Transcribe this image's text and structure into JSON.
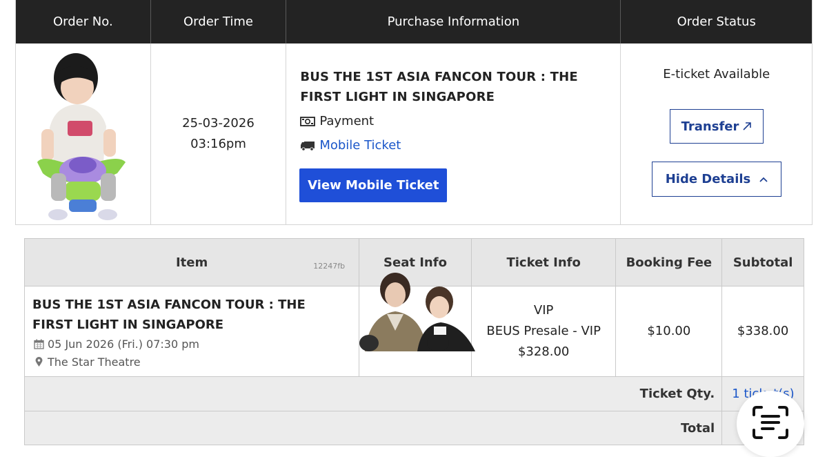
{
  "orders_table": {
    "headers": [
      "Order No.",
      "Order Time",
      "Purchase Information",
      "Order Status"
    ],
    "order_date": "25-03-2026",
    "order_time": "03:16pm",
    "event_title": "BUS THE 1ST ASIA FANCON TOUR : THE FIRST LIGHT IN SINGAPORE",
    "payment_label": "Payment",
    "delivery_label": "Mobile Ticket",
    "view_button": "View Mobile Ticket",
    "status": "E-ticket Available",
    "transfer_button": "Transfer",
    "hide_details_button": "Hide Details"
  },
  "details_table": {
    "headers": [
      "Item",
      "Seat Info",
      "Ticket Info",
      "Booking Fee",
      "Subtotal"
    ],
    "item_code": "12247fb",
    "item_title": "BUS THE 1ST ASIA FANCON TOUR : THE FIRST LIGHT IN SINGAPORE",
    "item_datetime": "05 Jun 2026 (Fri.) 07:30 pm",
    "item_venue": "The Star Theatre",
    "ticket_class": "VIP",
    "ticket_type": "BEUS Presale - VIP",
    "ticket_price": "$328.00",
    "booking_fee": "$10.00",
    "subtotal": "$338.00",
    "qty_label": "Ticket Qty.",
    "qty_value": "1 ticket(s)",
    "total_label": "Total",
    "total_value": ""
  },
  "colors": {
    "header_bg": "#232323",
    "primary_blue": "#1f4fd8",
    "outline_blue": "#1d3f92",
    "link_blue": "#1a56c9"
  },
  "icons": [
    "money-icon",
    "truck-icon",
    "arrow-up-right-icon",
    "chevron-up-icon",
    "calendar-icon",
    "map-pin-icon",
    "scan-text-icon"
  ]
}
